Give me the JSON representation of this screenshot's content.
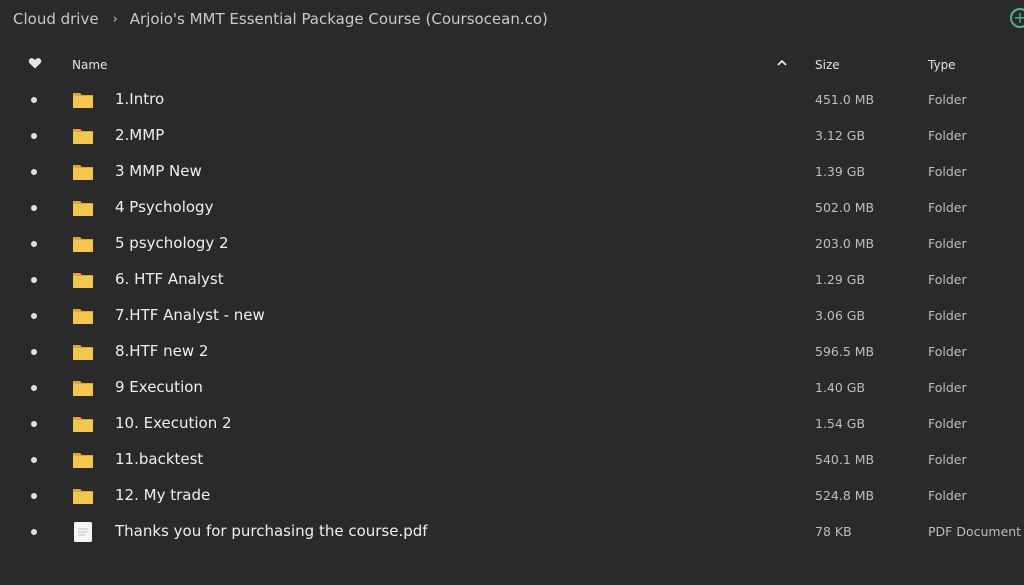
{
  "breadcrumb": {
    "root": "Cloud drive",
    "current": "Arjoio's MMT Essential Package Course (Coursocean.co)"
  },
  "header": {
    "name": "Name",
    "size": "Size",
    "type": "Type",
    "sort": "ascending"
  },
  "colors": {
    "folder": "#f5c64f",
    "add_accent": "#4fb38a",
    "background": "#2a2a2a"
  },
  "files": [
    {
      "name": "1.Intro",
      "size": "451.0 MB",
      "type": "Folder",
      "icon": "folder-icon"
    },
    {
      "name": "2.MMP",
      "size": "3.12 GB",
      "type": "Folder",
      "icon": "folder-icon"
    },
    {
      "name": "3 MMP New",
      "size": "1.39 GB",
      "type": "Folder",
      "icon": "folder-icon"
    },
    {
      "name": "4 Psychology",
      "size": "502.0 MB",
      "type": "Folder",
      "icon": "folder-icon"
    },
    {
      "name": "5 psychology 2",
      "size": "203.0 MB",
      "type": "Folder",
      "icon": "folder-icon"
    },
    {
      "name": "6. HTF Analyst",
      "size": "1.29 GB",
      "type": "Folder",
      "icon": "folder-icon"
    },
    {
      "name": "7.HTF Analyst - new",
      "size": "3.06 GB",
      "type": "Folder",
      "icon": "folder-icon"
    },
    {
      "name": "8.HTF new 2",
      "size": "596.5 MB",
      "type": "Folder",
      "icon": "folder-icon"
    },
    {
      "name": "9 Execution",
      "size": "1.40 GB",
      "type": "Folder",
      "icon": "folder-icon"
    },
    {
      "name": "10. Execution 2",
      "size": "1.54 GB",
      "type": "Folder",
      "icon": "folder-icon"
    },
    {
      "name": "11.backtest",
      "size": "540.1 MB",
      "type": "Folder",
      "icon": "folder-icon"
    },
    {
      "name": "12. My trade",
      "size": "524.8 MB",
      "type": "Folder",
      "icon": "folder-icon"
    },
    {
      "name": "Thanks you for purchasing the course.pdf",
      "size": "78 KB",
      "type": "PDF Document",
      "icon": "pdf-file-icon"
    }
  ]
}
